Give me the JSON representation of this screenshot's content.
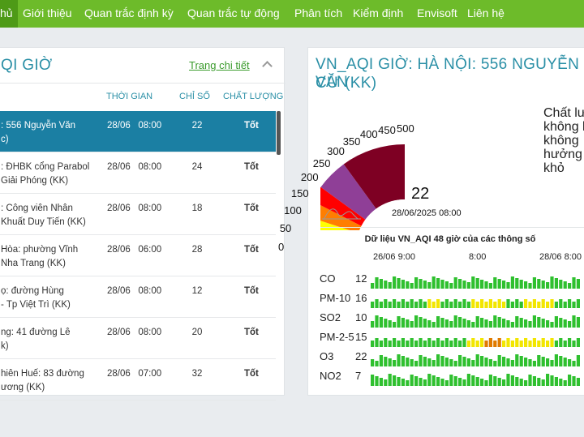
{
  "nav": {
    "items": [
      "hủ",
      "Giới thiệu",
      "Quan trắc định kỳ",
      "Quan trắc tự động",
      "Phân tích",
      "Kiểm định",
      "Envisoft",
      "Liên hệ"
    ]
  },
  "left_panel": {
    "title": "QI GIỜ",
    "detail_link": "Trang chi tiết",
    "columns": [
      "THỜI GIAN",
      "CHỈ SỐ",
      "CHẤT LƯỢNG"
    ],
    "rows": [
      {
        "name": ": 556 Nguyễn Văn\nc)",
        "date": "28/06",
        "time": "08:00",
        "value": "22",
        "quality": "Tốt"
      },
      {
        "name": ": ĐHBK cổng Parabol\nGiải Phóng (KK)",
        "date": "28/06",
        "time": "08:00",
        "value": "24",
        "quality": "Tốt"
      },
      {
        "name": ": Công viên Nhân\nKhuất Duy Tiến (KK)",
        "date": "28/06",
        "time": "08:00",
        "value": "18",
        "quality": "Tốt"
      },
      {
        "name": "Hòa: phường Vĩnh\nNha Trang (KK)",
        "date": "28/06",
        "time": "06:00",
        "value": "28",
        "quality": "Tốt"
      },
      {
        "name": "ọ: đường Hùng\n- Tp Việt Trì (KK)",
        "date": "28/06",
        "time": "08:00",
        "value": "12",
        "quality": "Tốt"
      },
      {
        "name": "ng: 41 đường Lê\nk)",
        "date": "28/06",
        "time": "08:00",
        "value": "20",
        "quality": "Tốt"
      },
      {
        "name": "hiên Huế: 83 đường\nương (KK)",
        "date": "28/06",
        "time": "07:00",
        "value": "32",
        "quality": "Tốt"
      }
    ]
  },
  "right_panel": {
    "title_line1": "VN_AQI GIỜ: HÀ NỘI: 556 NGUYỄN VĂN",
    "title_line2": "CỪ (KK)",
    "gauge": {
      "value": "22",
      "value_num": 22,
      "max": 500,
      "timestamp": "28/06/2025 08:00",
      "ticks": [
        "0",
        "50",
        "100",
        "150",
        "200",
        "250",
        "300",
        "350",
        "400",
        "450",
        "500"
      ],
      "band_colors": [
        "#33cc33",
        "#ffff00",
        "#ff7e00",
        "#ff0000",
        "#8f3f97",
        "#7e0023"
      ]
    },
    "caption": [
      "Chất lư",
      "không k",
      "không",
      "hưởng t",
      "khỏ"
    ],
    "mini": {
      "title": "Dữ liệu VN_AQI 48 giờ của các thông số",
      "time_labels": [
        "26/06 9:00",
        "8:00",
        "28/06 8:00"
      ],
      "params": [
        {
          "name": "CO",
          "value": "12"
        },
        {
          "name": "PM-10",
          "value": "16"
        },
        {
          "name": "SO2",
          "value": "10"
        },
        {
          "name": "PM-2-5",
          "value": "15"
        },
        {
          "name": "O3",
          "value": "22"
        },
        {
          "name": "NO2",
          "value": "7"
        }
      ],
      "colors": {
        "good": "#2fc02f",
        "moderate": "#f2e600",
        "poor": "#e07a00"
      }
    }
  }
}
